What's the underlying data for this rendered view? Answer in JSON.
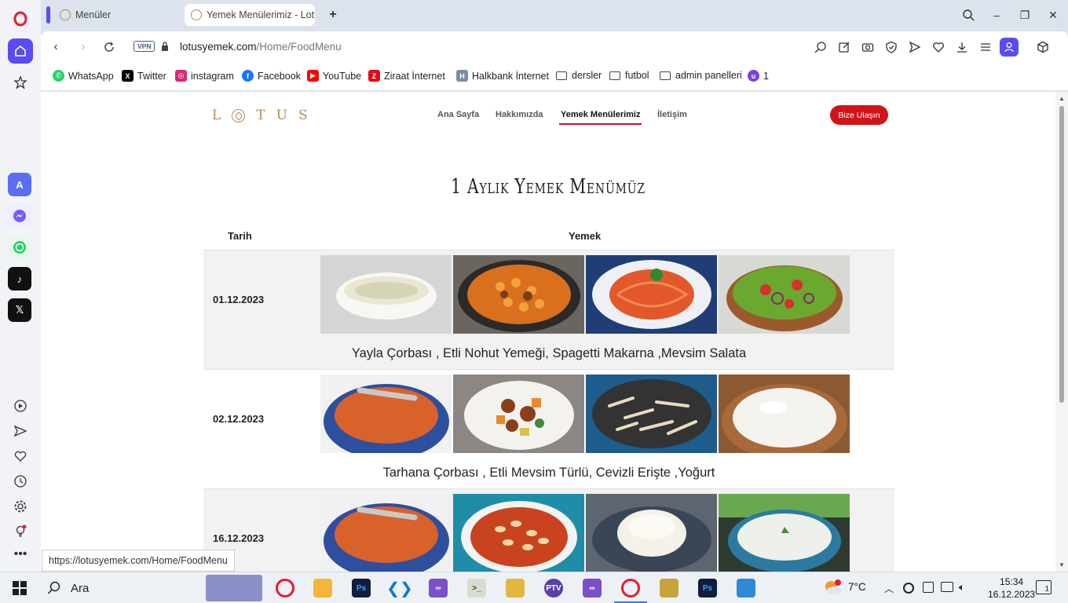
{
  "browser": {
    "tabs": [
      {
        "label": "Menüler"
      },
      {
        "label": "Yemek Menülerimiz - Lotu"
      }
    ],
    "vpn_label": "VPN",
    "url_domain": "lotusyemek.com",
    "url_path": "/Home/FoodMenu",
    "status_url": "https://lotusyemek.com/Home/FoodMenu",
    "win_controls": {
      "minimize": "–",
      "restore": "❐",
      "close": "✕",
      "new_tab": "+"
    }
  },
  "bookmarks": [
    {
      "label": "WhatsApp",
      "icon": "whatsapp-icon",
      "color": "#25d366"
    },
    {
      "label": "Twitter",
      "icon": "x-icon",
      "color": "#000000"
    },
    {
      "label": "instagram",
      "icon": "instagram-icon",
      "color": "#d62976"
    },
    {
      "label": "Facebook",
      "icon": "facebook-icon",
      "color": "#1877f2"
    },
    {
      "label": "YouTube",
      "icon": "youtube-icon",
      "color": "#ff0000"
    },
    {
      "label": "Ziraat İnternet",
      "icon": "ziraat-icon",
      "color": "#e30a17"
    },
    {
      "label": "Halkbank İnternet",
      "icon": "halkbank-icon",
      "color": "#7a8ba6"
    },
    {
      "label": "dersler",
      "icon": "folder-icon"
    },
    {
      "label": "futbol",
      "icon": "folder-icon"
    },
    {
      "label": "admin panelleri",
      "icon": "folder-icon"
    },
    {
      "label": "1",
      "icon": "extension-icon",
      "color": "#7b3fe4"
    }
  ],
  "site": {
    "logo": "LOTUS",
    "nav": [
      {
        "label": "Ana Sayfa"
      },
      {
        "label": "Hakkımızda"
      },
      {
        "label": "Yemek Menülerimiz",
        "active": true
      },
      {
        "label": "İletişim"
      }
    ],
    "contact_button": "Bize Ulaşın",
    "title": "1 Aylık Yemek Menümüz",
    "table": {
      "headers": [
        "Tarih",
        "Yemek"
      ],
      "rows": [
        {
          "date": "01.12.2023",
          "meals": "Yayla Çorbası , Etli Nohut Yemeği, Spagetti Makarna ,Mevsim Salata",
          "images": [
            "yayla-corbasi",
            "etli-nohut",
            "spagetti",
            "mevsim-salata"
          ]
        },
        {
          "date": "02.12.2023",
          "meals": "Tarhana Çorbası , Etli Mevsim Türlü, Cevizli Erişte ,Yoğurt",
          "images": [
            "tarhana-corbasi",
            "etli-turlu",
            "cevizli-eriste",
            "yogurt"
          ]
        },
        {
          "date": "16.12.2023",
          "meals": "",
          "images": [
            "tarhana-corbasi",
            "kuru-fasulye",
            "pilav",
            "cacik"
          ]
        }
      ]
    }
  },
  "taskbar": {
    "search_label": "Ara",
    "weather": "7°C",
    "time": "15:34",
    "date": "16.12.2023",
    "notification_count": "1"
  }
}
